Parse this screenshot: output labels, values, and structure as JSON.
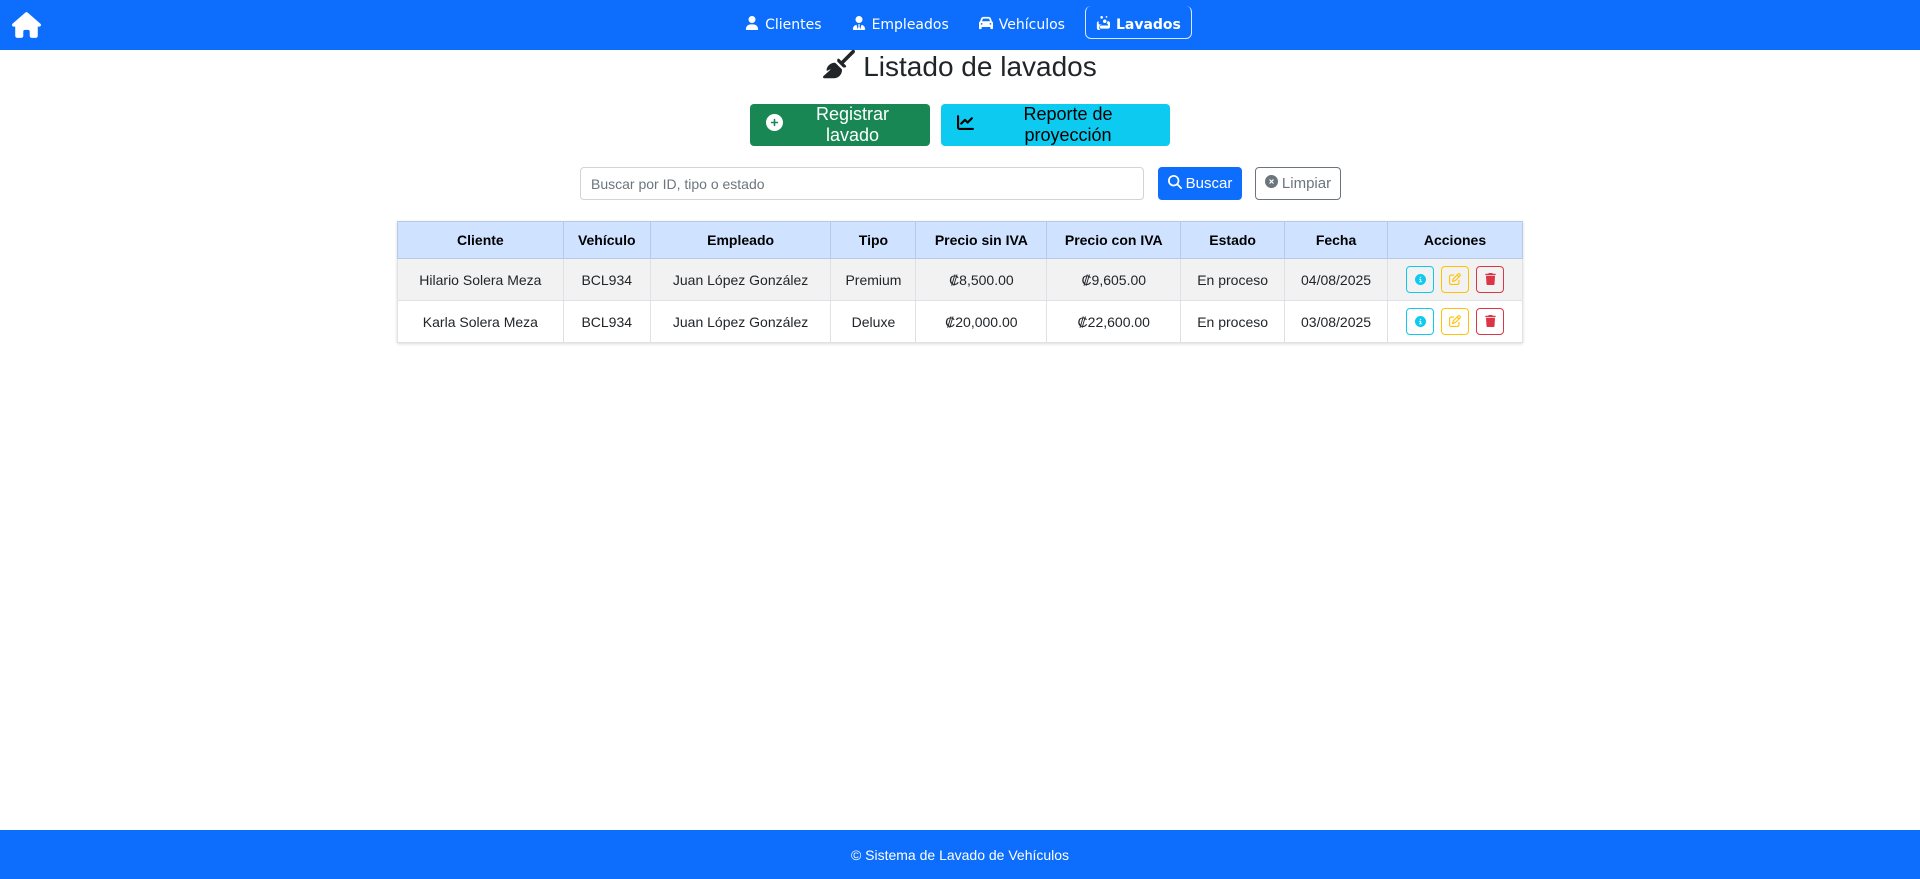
{
  "nav": {
    "home_icon": "home-icon",
    "links": [
      {
        "label": "Clientes",
        "icon": "user-icon",
        "active": false
      },
      {
        "label": "Empleados",
        "icon": "user-tie-icon",
        "active": false
      },
      {
        "label": "Vehículos",
        "icon": "car-icon",
        "active": false
      },
      {
        "label": "Lavados",
        "icon": "soap-icon",
        "active": true
      }
    ],
    "accent_color": "#0d6efd"
  },
  "page": {
    "title": "Listado de lavados",
    "title_icon": "broom-icon"
  },
  "actions": {
    "register_label": "Registrar lavado",
    "report_label": "Reporte de proyección"
  },
  "search": {
    "placeholder": "Buscar por ID, tipo o estado",
    "value": "",
    "search_label": "Buscar",
    "clear_label": "Limpiar"
  },
  "table": {
    "columns": [
      "Cliente",
      "Vehículo",
      "Empleado",
      "Tipo",
      "Precio sin IVA",
      "Precio con IVA",
      "Estado",
      "Fecha",
      "Acciones"
    ],
    "rows": [
      {
        "cliente": "Hilario Solera Meza",
        "vehiculo": "BCL934",
        "empleado": "Juan López González",
        "tipo": "Premium",
        "precio_sin_iva": "₡8,500.00",
        "precio_con_iva": "₡9,605.00",
        "estado": "En proceso",
        "fecha": "04/08/2025"
      },
      {
        "cliente": "Karla Solera Meza",
        "vehiculo": "BCL934",
        "empleado": "Juan López González",
        "tipo": "Deluxe",
        "precio_sin_iva": "₡20,000.00",
        "precio_con_iva": "₡22,600.00",
        "estado": "En proceso",
        "fecha": "03/08/2025"
      }
    ]
  },
  "footer": {
    "text": "© Sistema de Lavado de Vehículos"
  },
  "colors": {
    "primary": "#0d6efd",
    "success": "#198754",
    "info": "#0dcaf0",
    "warning": "#ffc107",
    "danger": "#dc3545",
    "table_header": "#cfe2ff"
  }
}
